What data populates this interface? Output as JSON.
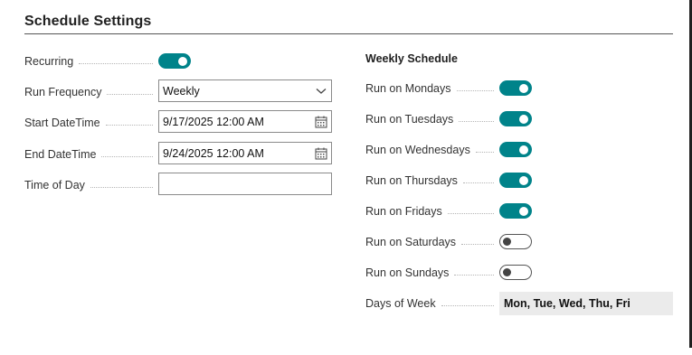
{
  "section": {
    "title": "Schedule Settings"
  },
  "left_fields": {
    "recurring": {
      "label": "Recurring",
      "value": true
    },
    "run_frequency": {
      "label": "Run Frequency",
      "value": "Weekly"
    },
    "start_datetime": {
      "label": "Start DateTime",
      "value": "9/17/2025 12:00 AM"
    },
    "end_datetime": {
      "label": "End DateTime",
      "value": "9/24/2025 12:00 AM"
    },
    "time_of_day": {
      "label": "Time of Day",
      "value": ""
    }
  },
  "weekly": {
    "heading": "Weekly Schedule",
    "days": [
      {
        "label": "Run on Mondays",
        "value": true
      },
      {
        "label": "Run on Tuesdays",
        "value": true
      },
      {
        "label": "Run on Wednesdays",
        "value": true
      },
      {
        "label": "Run on Thursdays",
        "value": true
      },
      {
        "label": "Run on Fridays",
        "value": true
      },
      {
        "label": "Run on Saturdays",
        "value": false
      },
      {
        "label": "Run on Sundays",
        "value": false
      }
    ],
    "days_of_week": {
      "label": "Days of Week",
      "value": "Mon, Tue, Wed, Thu, Fri"
    }
  },
  "icons": {
    "dropdown": "chevron-down-icon",
    "calendar": "calendar-icon"
  },
  "colors": {
    "accent": "#00838a"
  }
}
